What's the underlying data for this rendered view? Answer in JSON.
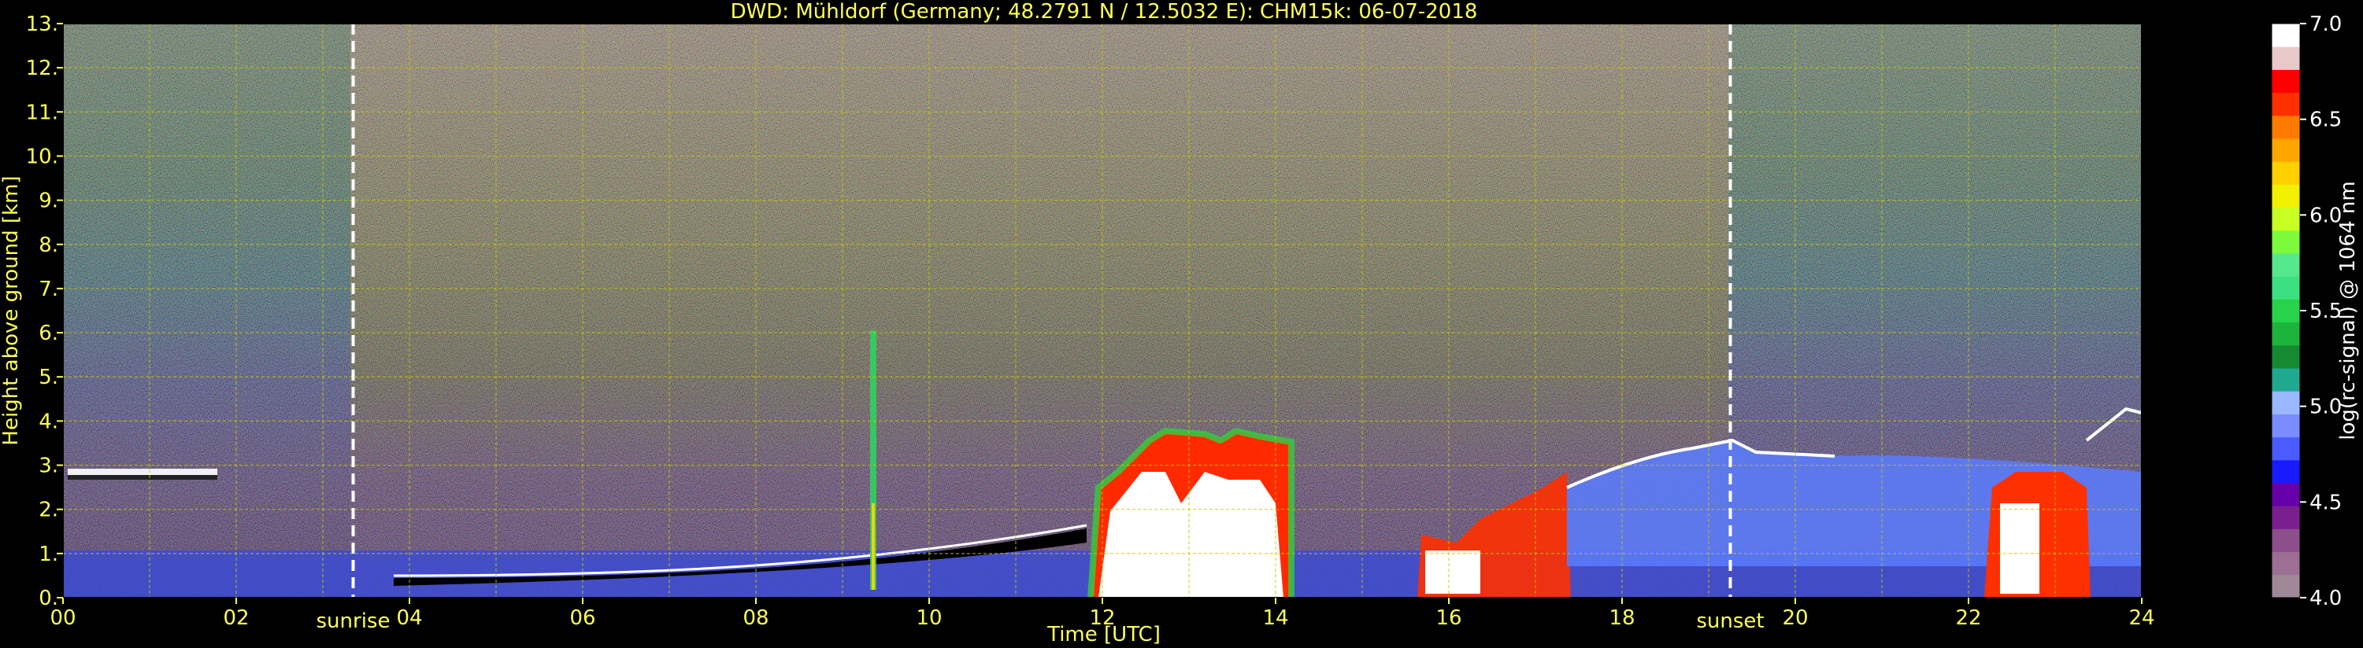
{
  "chart_data": {
    "type": "heatmap",
    "title": "DWD: Mühldorf (Germany; 48.2791 N / 12.5032 E):    CHM15k: 06-07-2018",
    "xlabel": "Time [UTC]",
    "ylabel": "Height above ground [km]",
    "xlim": [
      0,
      24
    ],
    "ylim": [
      0,
      13
    ],
    "x_ticks": [
      "00",
      "02",
      "04",
      "06",
      "08",
      "10",
      "12",
      "14",
      "16",
      "18",
      "20",
      "22",
      "24"
    ],
    "y_ticks": [
      "0.",
      "1.",
      "2.",
      "3.",
      "4.",
      "5.",
      "6.",
      "7.",
      "8.",
      "9.",
      "10.",
      "11.",
      "12.",
      "13."
    ],
    "grid": true,
    "annotations": [
      {
        "label": "sunrise",
        "time_utc": 3.35
      },
      {
        "label": "sunset",
        "time_utc": 19.25
      }
    ],
    "colorbar": {
      "label": "log(rc-signal) @ 1064 nm",
      "range": [
        4.0,
        7.0
      ],
      "ticks": [
        "4.0",
        "4.5",
        "5.0",
        "5.5",
        "6.0",
        "6.5",
        "7.0"
      ],
      "colors": [
        "#a08898",
        "#9c6f95",
        "#8c4f8c",
        "#7a1f8f",
        "#6600a8",
        "#1a1aff",
        "#4a5cff",
        "#7a8cff",
        "#9ab8ff",
        "#20a890",
        "#158a30",
        "#1cb43a",
        "#28d24a",
        "#3ce080",
        "#55e88c",
        "#7dfa3c",
        "#c8ff22",
        "#f0f000",
        "#ffd000",
        "#ffa500",
        "#ff7a00",
        "#ff3000",
        "#ff0000",
        "#e8c8c8",
        "#ffffff"
      ]
    },
    "features": {
      "cloud_top_early_km": 2.9,
      "boundary_layer_morning_km": 0.6,
      "convective_clouds_1200_1400_top_km": 3.7,
      "cloud_layer_evening_top_km": 3.5,
      "convective_clouds_2230_2330_top_km": 3.2
    }
  }
}
